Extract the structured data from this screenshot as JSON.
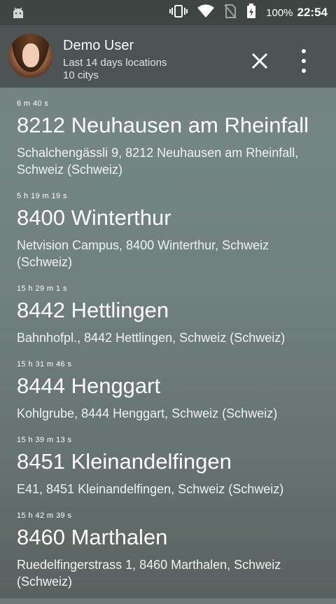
{
  "status_bar": {
    "battery_percent": "100%",
    "time": "22:54",
    "icons": [
      "android-icon",
      "vibrate-icon",
      "wifi-icon",
      "no-sim-icon",
      "battery-charging-icon"
    ]
  },
  "header": {
    "user_name": "Demo User",
    "subtitle": "Last 14 days locations",
    "count_text": "10 citys"
  },
  "locations": [
    {
      "duration": "6 m 40 s",
      "city": "8212 Neuhausen am Rheinfall",
      "address": "Schalchengässli 9, 8212 Neuhausen am Rheinfall, Schweiz (Schweiz)"
    },
    {
      "duration": "5 h 19 m 19 s",
      "city": "8400 Winterthur",
      "address": "Netvision Campus, 8400 Winterthur, Schweiz (Schweiz)"
    },
    {
      "duration": "15 h 29 m 1 s",
      "city": "8442 Hettlingen",
      "address": "Bahnhofpl., 8442 Hettlingen, Schweiz (Schweiz)"
    },
    {
      "duration": "15 h 31 m 46 s",
      "city": "8444 Henggart",
      "address": "Kohlgrube, 8444 Henggart, Schweiz (Schweiz)"
    },
    {
      "duration": "15 h 39 m 13 s",
      "city": "8451 Kleinandelfingen",
      "address": "E41, 8451 Kleinandelfingen, Schweiz (Schweiz)"
    },
    {
      "duration": "15 h 42 m 39 s",
      "city": "8460 Marthalen",
      "address": "Ruedelfingerstrass 1, 8460 Marthalen, Schweiz (Schweiz)"
    }
  ]
}
